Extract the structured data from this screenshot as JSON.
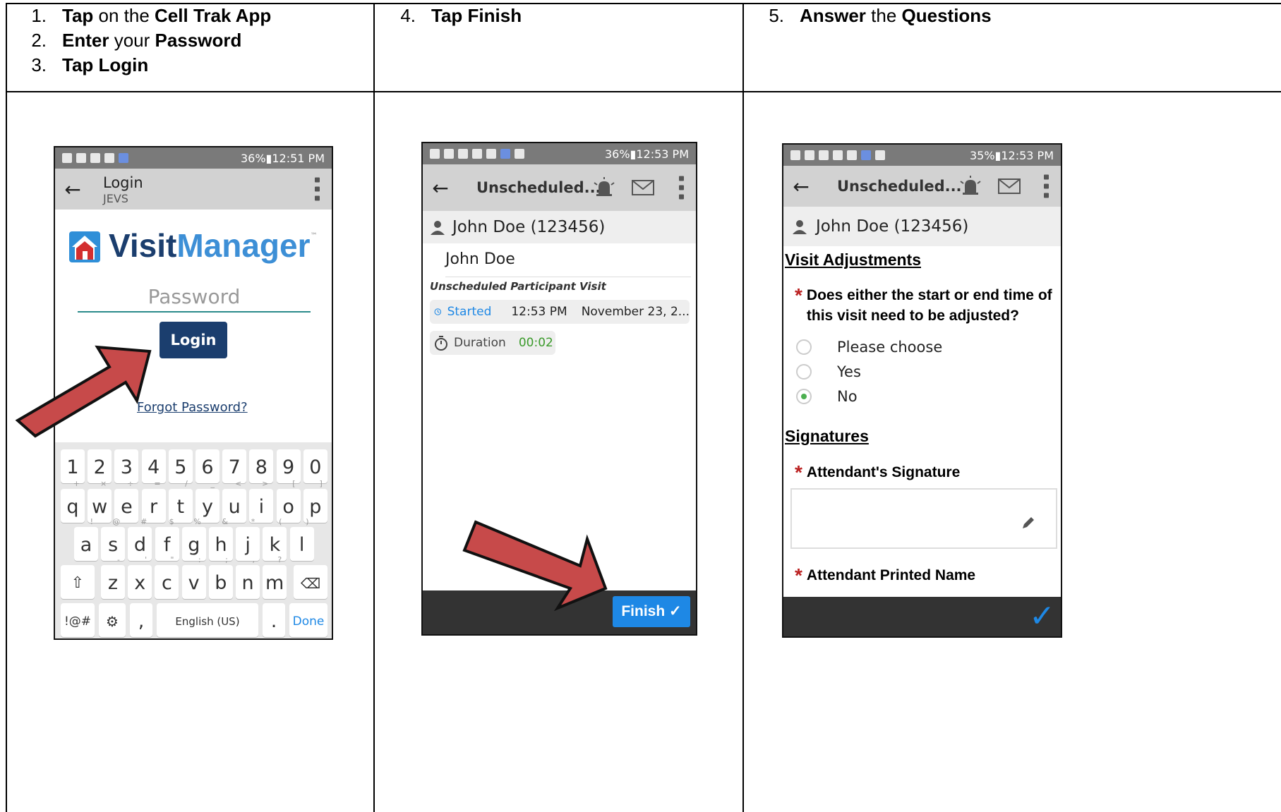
{
  "columns": [
    {
      "steps": [
        {
          "num": "1.",
          "parts": [
            {
              "t": "Tap",
              "b": true
            },
            {
              "t": " on the ",
              "b": false
            },
            {
              "t": "Cell Trak App",
              "b": true
            }
          ]
        },
        {
          "num": "2.",
          "parts": [
            {
              "t": "Enter",
              "b": true
            },
            {
              "t": " your ",
              "b": false
            },
            {
              "t": "Password",
              "b": true
            }
          ]
        },
        {
          "num": "3.",
          "parts": [
            {
              "t": "Tap Login",
              "b": true
            }
          ]
        }
      ]
    },
    {
      "steps": [
        {
          "num": "4.",
          "parts": [
            {
              "t": "Tap Finish",
              "b": true
            }
          ]
        }
      ]
    },
    {
      "steps": [
        {
          "num": "5.",
          "parts": [
            {
              "t": "Answer",
              "b": true
            },
            {
              "t": " the ",
              "b": false
            },
            {
              "t": "Questions",
              "b": true
            }
          ]
        }
      ]
    }
  ],
  "phone1": {
    "status": {
      "right": "36%▮12:51 PM"
    },
    "title": "Login",
    "subtitle": "JEVS",
    "logo_visit": "Visit",
    "logo_manager": "Manager",
    "logo_tm": "™",
    "password_placeholder": "Password",
    "login_label": "Login",
    "forgot": "Forgot Password?",
    "keyboard": {
      "row1": [
        "1",
        "2",
        "3",
        "4",
        "5",
        "6",
        "7",
        "8",
        "9",
        "0"
      ],
      "row2": [
        "q",
        "w",
        "e",
        "r",
        "t",
        "y",
        "u",
        "i",
        "o",
        "p"
      ],
      "row2_hints": [
        "+",
        "×",
        "÷",
        "=",
        "/",
        "_",
        "<",
        ">",
        "[",
        "]"
      ],
      "row3": [
        "a",
        "s",
        "d",
        "f",
        "g",
        "h",
        "j",
        "k",
        "l"
      ],
      "row3_hints": [
        "!",
        "@",
        "#",
        "$",
        "%",
        "&",
        "*",
        "(",
        ")"
      ],
      "row4": [
        "z",
        "x",
        "c",
        "v",
        "b",
        "n",
        "m"
      ],
      "row4_hints": [
        "-",
        "'",
        "\"",
        ":",
        ";",
        ",",
        "?"
      ],
      "sym": "!@#",
      "comma": ",",
      "space": "English (US)",
      "period": ".",
      "done": "Done"
    }
  },
  "phone2": {
    "status": {
      "right": "36%▮12:53 PM"
    },
    "title": "Unscheduled...",
    "participant": "John Doe (123456)",
    "name": "John Doe",
    "visit_type": "Unscheduled Participant Visit",
    "started_label": "Started",
    "started_time": "12:53 PM",
    "started_date": "November 23, 2...",
    "duration_label": "Duration",
    "duration_value": "00:02",
    "finish_label": "Finish ✓"
  },
  "phone3": {
    "status": {
      "right": "35%▮12:53 PM"
    },
    "title": "Unscheduled...",
    "participant": "John Doe (123456)",
    "section1": "Visit Adjustments",
    "question": "Does either the start or end time of this visit need to be adjusted?",
    "options": [
      "Please choose",
      "Yes",
      "No"
    ],
    "selected_index": 2,
    "section2": "Signatures",
    "sig_label": "Attendant's Signature",
    "printed_label": "Attendant Printed Name",
    "check": "✓"
  },
  "colors": {
    "accent_blue": "#1e88e5",
    "login_navy": "#1b3e6e",
    "arrow_red": "#c74a4a",
    "duration_green": "#3a9a2a"
  }
}
